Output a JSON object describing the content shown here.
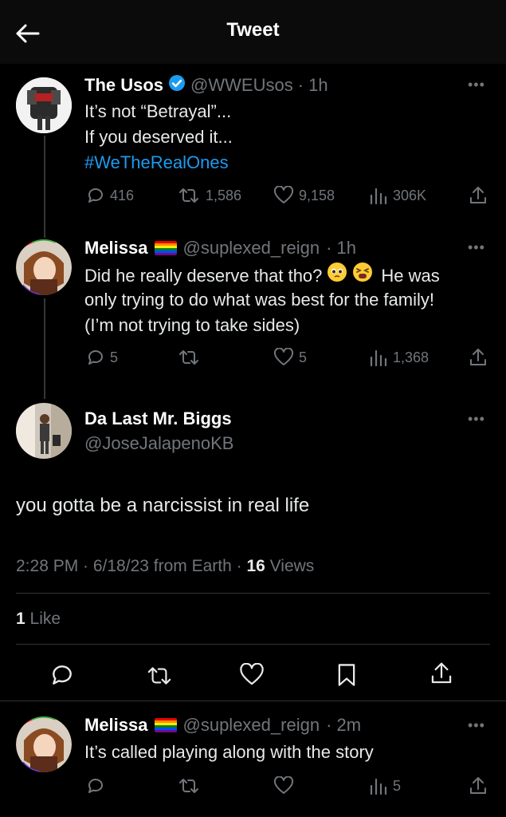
{
  "header": {
    "title": "Tweet"
  },
  "tweet1": {
    "name": "The Usos",
    "handle": "@WWEUsos",
    "time": "· 1h",
    "lines": [
      "It’s not “Betrayal”...",
      "If you deserved it..."
    ],
    "hashtag": "#WeTheRealOnes",
    "replies": "416",
    "retweets": "1,586",
    "likes": "9,158",
    "views": "306K"
  },
  "tweet2": {
    "name": "Melissa",
    "handle": "@suplexed_reign",
    "time": "· 1h",
    "line1": "Did he really deserve that tho?",
    "line1_end": "He was",
    "line2": "only trying to do what was best for the family!",
    "line3": "(I’m not trying to take sides)",
    "replies": "5",
    "likes": "5",
    "views": "1,368"
  },
  "main_tweet": {
    "name": "Da Last Mr. Biggs",
    "handle": "@JoseJalapenoKB",
    "text": "you gotta be a narcissist in real life",
    "meta_prefix": "2:28 PM · 6/18/23 from Earth · ",
    "views_count": "16",
    "views_label": " Views",
    "likes_count": "1",
    "likes_label": " Like"
  },
  "reply": {
    "name": "Melissa",
    "handle": "@suplexed_reign",
    "time": "· 2m",
    "text": "It’s called playing along with the story",
    "views": "5"
  },
  "colors": {
    "link": "#1d9bf0",
    "verified": "#1d9bf0",
    "muted": "#71767b"
  }
}
